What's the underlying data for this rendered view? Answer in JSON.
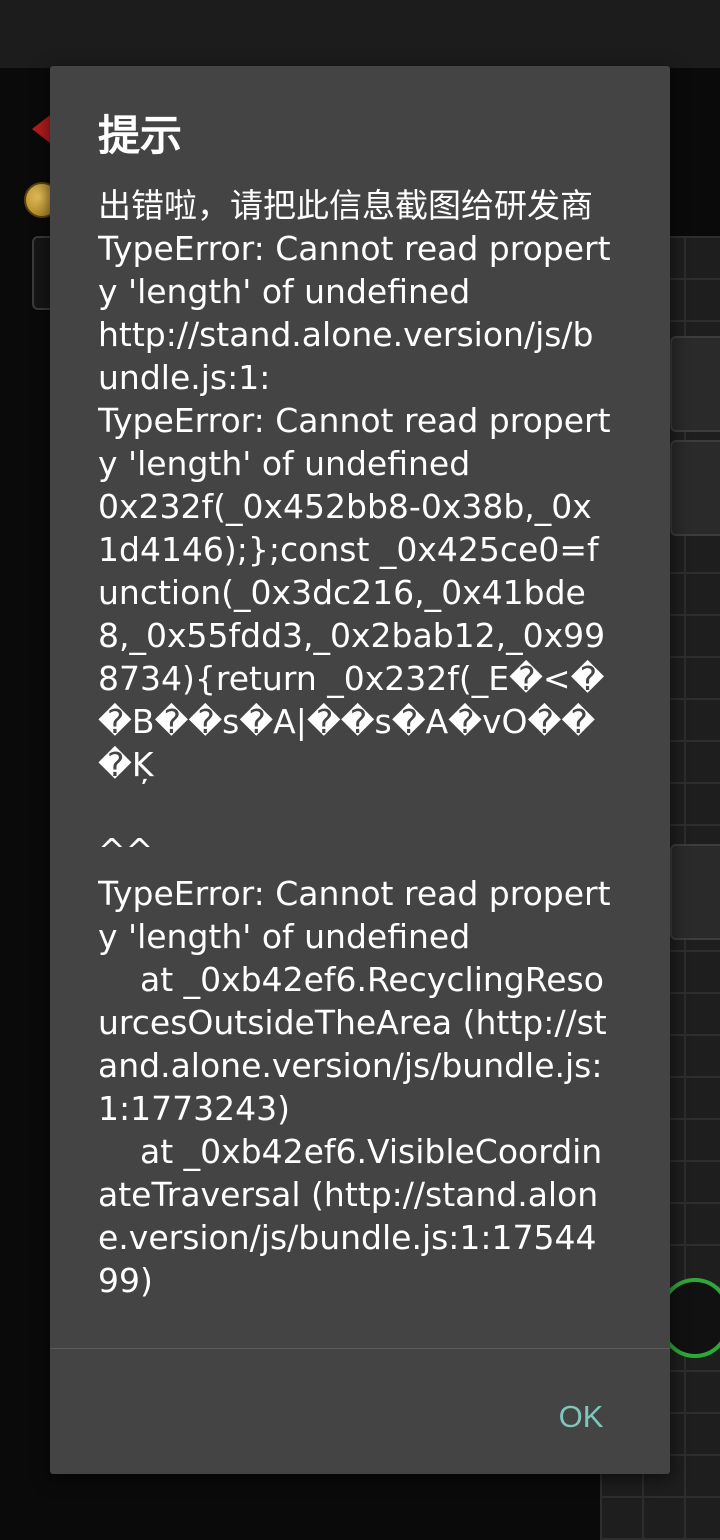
{
  "dialog": {
    "title": "提示",
    "message": "出错啦，请把此信息截图给研发商\nTypeError: Cannot read property 'length' of undefined\nhttp://stand.alone.version/js/bundle.js:1:\nTypeError: Cannot read property 'length' of undefined\n0x232f(_0x452bb8-0x38b,_0x1d4146);};const _0x425ce0=function(_0x3dc216,_0x41bde8,_0x55fdd3,_0x2bab12,_0x998734){return _0x232f(_E�<��B��s�A|��s�A�vO���Ķ\n\n^^\nTypeError: Cannot read property 'length' of undefined\n    at _0xb42ef6.RecyclingResourcesOutsideTheArea (http://stand.alone.version/js/bundle.js:1:1773243)\n    at _0xb42ef6.VisibleCoordinateTraversal (http://stand.alone.version/js/bundle.js:1:1754499)",
    "ok_label": "OK"
  },
  "colors": {
    "dialog_bg": "#444444",
    "text": "#ffffff",
    "accent_ok": "#7fc6bd"
  }
}
